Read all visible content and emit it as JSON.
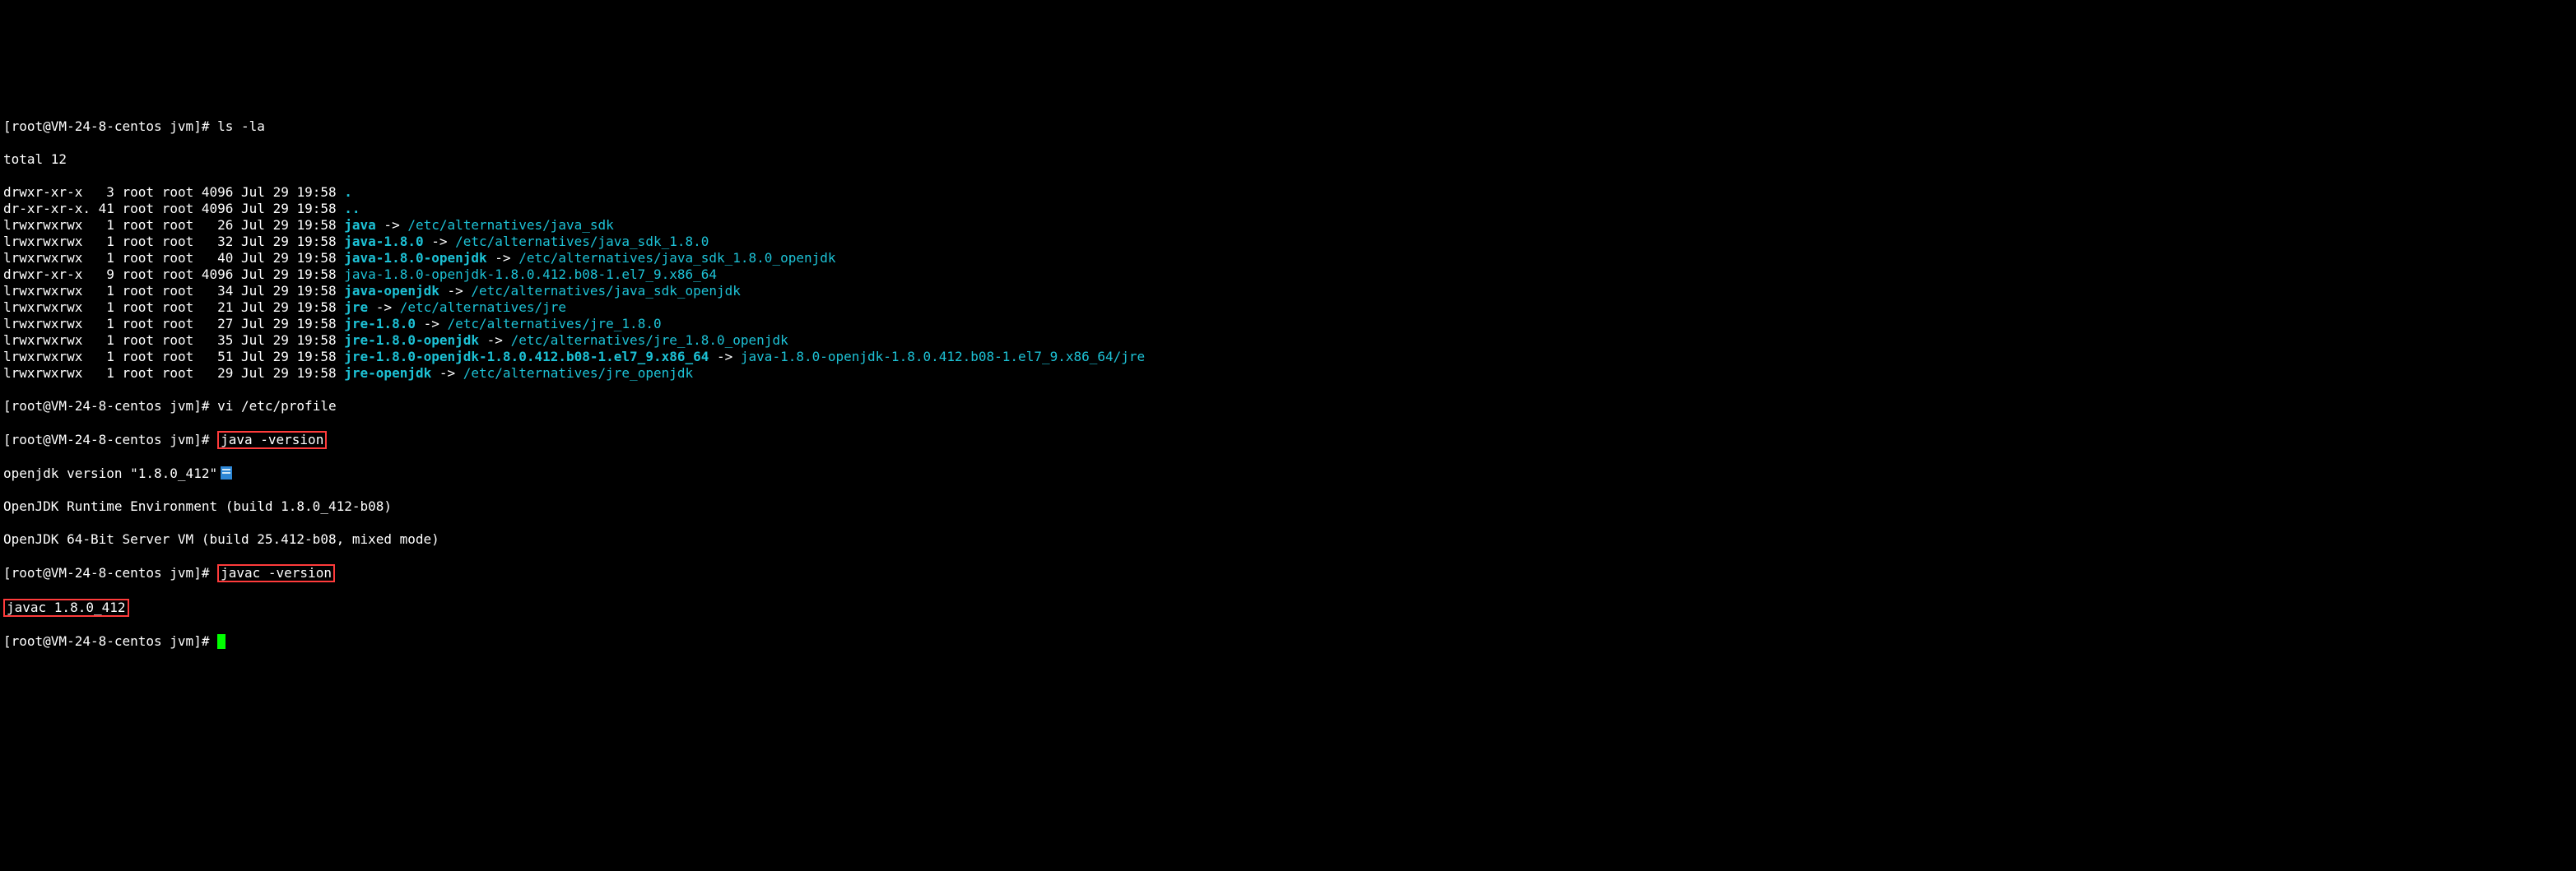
{
  "prompt": {
    "ps1_base": "[root@VM-24-8-centos jvm]#",
    "cmd_ls": "ls -la",
    "cmd_vi": "vi /etc/profile",
    "cmd_java_version": "java -version",
    "cmd_javac_version": "javac -version"
  },
  "ls": {
    "total_line": "total 12",
    "entries": [
      {
        "perm": "drwxr-xr-x",
        "dot": " ",
        "lnk": "3",
        "own": "root",
        "grp": "root",
        "sz": "4096",
        "date": "Jul 29 19:58",
        "name": ".",
        "name_class": "bcyan",
        "tgt": ""
      },
      {
        "perm": "dr-xr-xr-x.",
        "dot": "",
        "lnk": "41",
        "own": "root",
        "grp": "root",
        "sz": "4096",
        "date": "Jul 29 19:58",
        "name": "..",
        "name_class": "bcyan",
        "tgt": ""
      },
      {
        "perm": "lrwxrwxrwx",
        "dot": " ",
        "lnk": "1",
        "own": "root",
        "grp": "root",
        "sz": "26",
        "date": "Jul 29 19:58",
        "name": "java",
        "name_class": "bcyan",
        "tgt": "/etc/alternatives/java_sdk",
        "tgt_class": "cyan"
      },
      {
        "perm": "lrwxrwxrwx",
        "dot": " ",
        "lnk": "1",
        "own": "root",
        "grp": "root",
        "sz": "32",
        "date": "Jul 29 19:58",
        "name": "java-1.8.0",
        "name_class": "bcyan",
        "tgt": "/etc/alternatives/java_sdk_1.8.0",
        "tgt_class": "cyan"
      },
      {
        "perm": "lrwxrwxrwx",
        "dot": " ",
        "lnk": "1",
        "own": "root",
        "grp": "root",
        "sz": "40",
        "date": "Jul 29 19:58",
        "name": "java-1.8.0-openjdk",
        "name_class": "bcyan",
        "tgt": "/etc/alternatives/java_sdk_1.8.0_openjdk",
        "tgt_class": "cyan"
      },
      {
        "perm": "drwxr-xr-x",
        "dot": " ",
        "lnk": "9",
        "own": "root",
        "grp": "root",
        "sz": "4096",
        "date": "Jul 29 19:58",
        "name": "java-1.8.0-openjdk-1.8.0.412.b08-1.el7_9.x86_64",
        "name_class": "cyan",
        "tgt": ""
      },
      {
        "perm": "lrwxrwxrwx",
        "dot": " ",
        "lnk": "1",
        "own": "root",
        "grp": "root",
        "sz": "34",
        "date": "Jul 29 19:58",
        "name": "java-openjdk",
        "name_class": "bcyan",
        "tgt": "/etc/alternatives/java_sdk_openjdk",
        "tgt_class": "cyan"
      },
      {
        "perm": "lrwxrwxrwx",
        "dot": " ",
        "lnk": "1",
        "own": "root",
        "grp": "root",
        "sz": "21",
        "date": "Jul 29 19:58",
        "name": "jre",
        "name_class": "bcyan",
        "tgt": "/etc/alternatives/jre",
        "tgt_class": "cyan"
      },
      {
        "perm": "lrwxrwxrwx",
        "dot": " ",
        "lnk": "1",
        "own": "root",
        "grp": "root",
        "sz": "27",
        "date": "Jul 29 19:58",
        "name": "jre-1.8.0",
        "name_class": "bcyan",
        "tgt": "/etc/alternatives/jre_1.8.0",
        "tgt_class": "cyan"
      },
      {
        "perm": "lrwxrwxrwx",
        "dot": " ",
        "lnk": "1",
        "own": "root",
        "grp": "root",
        "sz": "35",
        "date": "Jul 29 19:58",
        "name": "jre-1.8.0-openjdk",
        "name_class": "bcyan",
        "tgt": "/etc/alternatives/jre_1.8.0_openjdk",
        "tgt_class": "cyan"
      },
      {
        "perm": "lrwxrwxrwx",
        "dot": " ",
        "lnk": "1",
        "own": "root",
        "grp": "root",
        "sz": "51",
        "date": "Jul 29 19:58",
        "name": "jre-1.8.0-openjdk-1.8.0.412.b08-1.el7_9.x86_64",
        "name_class": "bcyan",
        "tgt": "java-1.8.0-openjdk-1.8.0.412.b08-1.el7_9.x86_64/jre",
        "tgt_class": "cyan"
      },
      {
        "perm": "lrwxrwxrwx",
        "dot": " ",
        "lnk": "1",
        "own": "root",
        "grp": "root",
        "sz": "29",
        "date": "Jul 29 19:58",
        "name": "jre-openjdk",
        "name_class": "bcyan",
        "tgt": "/etc/alternatives/jre_openjdk",
        "tgt_class": "cyan"
      }
    ]
  },
  "java_version_output": {
    "l1": "openjdk version \"1.8.0_412\"",
    "l2": "OpenJDK Runtime Environment (build 1.8.0_412-b08)",
    "l3": "OpenJDK 64-Bit Server VM (build 25.412-b08, mixed mode)"
  },
  "javac_version_output": "javac 1.8.0_412",
  "arrow": " -> "
}
